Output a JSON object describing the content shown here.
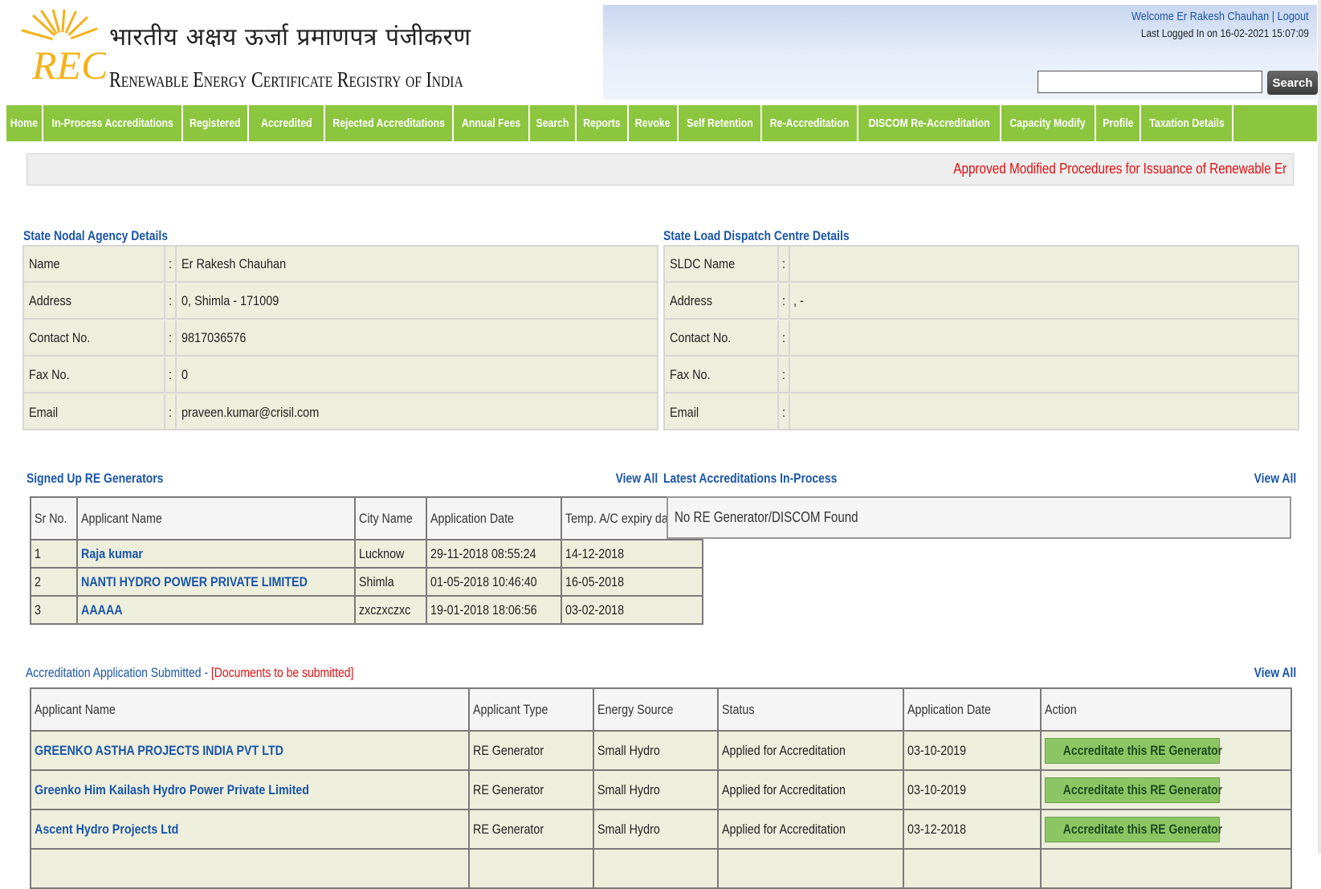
{
  "header": {
    "hindi_title": "भारतीय अक्षय ऊर्जा प्रमाणपत्र पंजीकरण",
    "english_title": "Renewable Energy Certificate Registry of India",
    "logo_text": "REC",
    "welcome": "Welcome Er Rakesh Chauhan",
    "logout": "Logout",
    "last_logged": "Last Logged In on 16-02-2021 15:07:09",
    "search_value": "",
    "search_button": "Search"
  },
  "nav": [
    "Home",
    "In-Process Accreditations",
    "Registered",
    "Accredited",
    "Rejected Accreditations",
    "Annual Fees",
    "Search",
    "Reports",
    "Revoke",
    "Self Retention",
    "Re-Accreditation",
    "DISCOM Re-Accreditation",
    "Capacity Modify",
    "Profile",
    "Taxation Details"
  ],
  "marquee": "Approved Modified Procedures for Issuance of Renewable Er",
  "state_nodal": {
    "title": "State Nodal Agency Details",
    "rows": [
      {
        "label": "Name",
        "value": "Er Rakesh Chauhan"
      },
      {
        "label": "Address",
        "value": "0, Shimla - 171009"
      },
      {
        "label": "Contact No.",
        "value": "9817036576"
      },
      {
        "label": "Fax No.",
        "value": "0"
      },
      {
        "label": "Email",
        "value": "praveen.kumar@crisil.com"
      }
    ]
  },
  "sldc": {
    "title": "State Load Dispatch Centre Details",
    "rows": [
      {
        "label": "SLDC Name",
        "value": ""
      },
      {
        "label": "Address",
        "value": ", -"
      },
      {
        "label": "Contact No.",
        "value": ""
      },
      {
        "label": "Fax No.",
        "value": ""
      },
      {
        "label": "Email",
        "value": ""
      }
    ]
  },
  "separator": ":",
  "signed_up": {
    "title": "Signed Up RE Generators",
    "view_all": "View All",
    "headers": [
      "Sr No.",
      "Applicant Name",
      "City Name",
      "Application Date",
      "Temp. A/C expiry date"
    ],
    "rows": [
      [
        "1",
        "Raja kumar",
        "Lucknow",
        "29-11-2018 08:55:24",
        "14-12-2018"
      ],
      [
        "2",
        "NANTI HYDRO POWER PRIVATE LIMITED",
        "Shimla",
        "01-05-2018 10:46:40",
        "16-05-2018"
      ],
      [
        "3",
        "AAAAA",
        "zxczxczxc",
        "19-01-2018 18:06:56",
        "03-02-2018"
      ]
    ]
  },
  "latest": {
    "title": "Latest Accreditations In-Process",
    "view_all": "View All",
    "empty_message": "No RE Generator/DISCOM Found"
  },
  "accreditation": {
    "title": "Accreditation Application Submitted - ",
    "title_note": "[Documents to be submitted]",
    "view_all": "View All",
    "headers": [
      "Applicant Name",
      "Applicant Type",
      "Energy Source",
      "Status",
      "Application Date",
      "Action"
    ],
    "rows": [
      [
        "GREENKO ASTHA PROJECTS INDIA PVT LTD",
        "RE Generator",
        "Small Hydro",
        "Applied for Accreditation",
        "03-10-2019",
        "Accreditate this RE Generator"
      ],
      [
        "Greenko Him Kailash Hydro Power Private Limited",
        "RE Generator",
        "Small Hydro",
        "Applied for Accreditation",
        "03-10-2019",
        "Accreditate this RE Generator"
      ],
      [
        "Ascent Hydro Projects Ltd",
        "RE Generator",
        "Small Hydro",
        "Applied for Accreditation",
        "03-12-2018",
        "Accreditate this RE Generator"
      ]
    ]
  },
  "colors": {
    "nav_green": "#8cc63e",
    "link_blue": "#1a56a8",
    "alert_red": "#e01010",
    "table_bg": "#eeeedd",
    "button_green": "#8cc664"
  }
}
